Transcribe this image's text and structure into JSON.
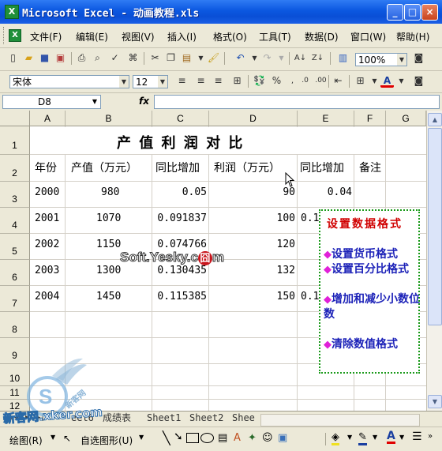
{
  "window": {
    "title": "Microsoft Excel - 动画教程.xls",
    "app_icon": "X",
    "min": "_",
    "max": "□",
    "close": "×"
  },
  "menu": [
    "文件(F)",
    "编辑(E)",
    "视图(V)",
    "插入(I)",
    "格式(O)",
    "工具(T)",
    "数据(D)",
    "窗口(W)",
    "帮助(H)"
  ],
  "toolbar": {
    "zoom": "100%",
    "font": "宋体",
    "size": "12"
  },
  "formula_bar": {
    "name_box": "D8",
    "fx": "fx",
    "value": ""
  },
  "columns": [
    "A",
    "B",
    "C",
    "D",
    "E",
    "F",
    "G"
  ],
  "rows": [
    "1",
    "2",
    "3",
    "4",
    "5",
    "6",
    "7",
    "8",
    "9",
    "10",
    "11",
    "12"
  ],
  "sheet": {
    "title": "产 值 利 润 对 比",
    "headers": [
      "年份",
      "产值（万元）",
      "同比增加",
      "利润（万元）",
      "同比增加",
      "备注"
    ],
    "data": [
      [
        "2000",
        "980",
        "0.05",
        "90",
        "0.04"
      ],
      [
        "2001",
        "1070",
        "0.091837",
        "100",
        "0.1"
      ],
      [
        "2002",
        "1150",
        "0.074766",
        "120",
        ""
      ],
      [
        "2003",
        "1300",
        "0.130435",
        "132",
        ""
      ],
      [
        "2004",
        "1450",
        "0.115385",
        "150",
        "0.1"
      ]
    ]
  },
  "callout": {
    "title": "设置数据格式",
    "bullet": "◆",
    "items": [
      "设置货币格式",
      "设置百分比格式",
      "增加和减少小数位数",
      "清除数值格式"
    ]
  },
  "tabs": [
    "eet6",
    "成绩表",
    "Sheet1",
    "Sheet2",
    "Shee"
  ],
  "drawbar": {
    "draw": "绘图(R)",
    "autoshapes": "自选图形(U)"
  },
  "watermarks": {
    "center": "Soft.Yesky.c",
    "center_tail": "m",
    "bottom": "新客网.xker.com",
    "bottom_small": "新客网"
  },
  "colors": {
    "titlebar": "#0b57e0",
    "callout_border": "#1a9a1a",
    "callout_title": "#d00000",
    "callout_text": "#1c22b8",
    "bullet": "#e020d8"
  }
}
